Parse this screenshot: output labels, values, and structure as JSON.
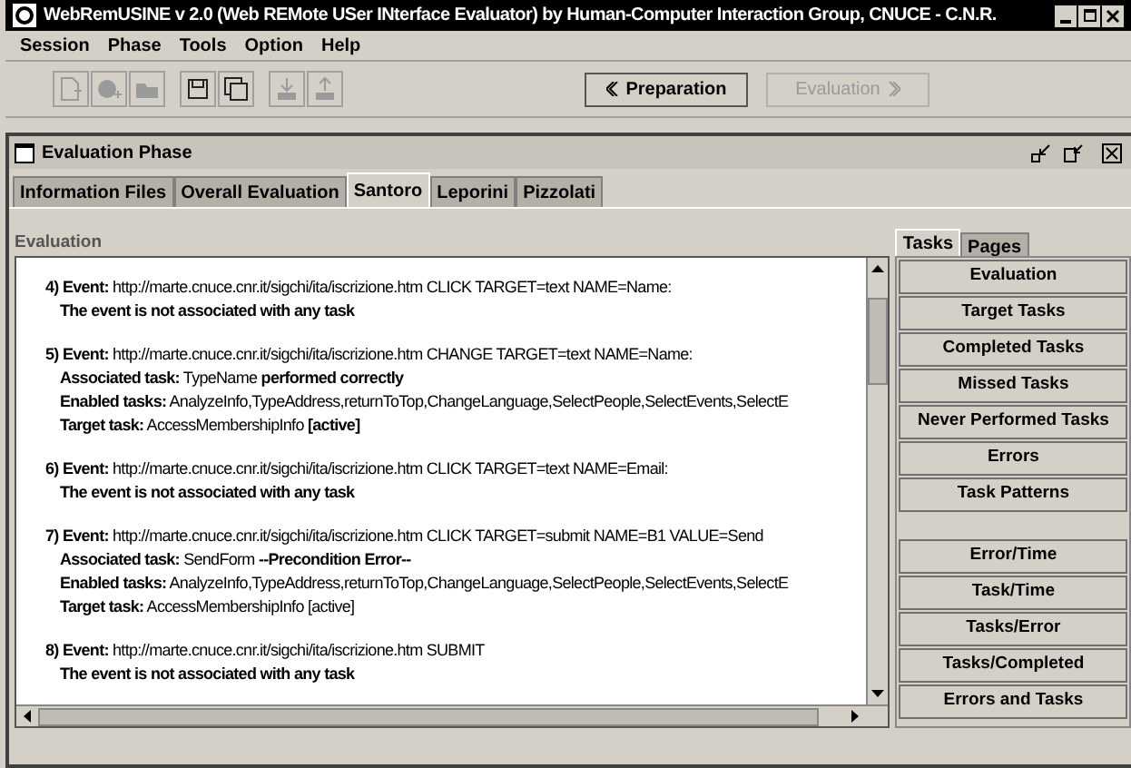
{
  "window": {
    "title": "WebRemUSINE v 2.0 (Web REMote USer INterface Evaluator) by Human-Computer Interaction Group, CNUCE - C.N.R."
  },
  "menu": [
    "Session",
    "Phase",
    "Tools",
    "Option",
    "Help"
  ],
  "toolbar": {
    "icons": [
      {
        "kind": "doc",
        "disabled": true
      },
      {
        "kind": "globe",
        "disabled": true
      },
      {
        "kind": "folder",
        "disabled": true
      },
      {
        "kind": "save",
        "disabled": false
      },
      {
        "kind": "saveall",
        "disabled": false
      },
      {
        "kind": "down",
        "disabled": true
      },
      {
        "kind": "up",
        "disabled": true
      }
    ],
    "nav": [
      {
        "label": "Preparation",
        "disabled": false
      },
      {
        "label": "Evaluation",
        "disabled": true
      }
    ]
  },
  "frame": {
    "title": "Evaluation Phase"
  },
  "tabs": [
    {
      "label": "Information Files",
      "selected": false
    },
    {
      "label": "Overall Evaluation",
      "selected": false
    },
    {
      "label": "Santoro",
      "selected": true
    },
    {
      "label": "Leporini",
      "selected": false
    },
    {
      "label": "Pizzolati",
      "selected": false
    }
  ],
  "evaluation": {
    "label": "Evaluation",
    "events": [
      {
        "lines": [
          {
            "text": "**4) Event:** http://marte.cnuce.cnr.it/sigchi/ita/iscrizione.htm CLICK TARGET=text NAME=Name:",
            "bold": false
          },
          {
            "text": "The event is not associated with any task",
            "bold": true
          }
        ]
      },
      {
        "lines": [
          {
            "text": "**5) Event:** http://marte.cnuce.cnr.it/sigchi/ita/iscrizione.htm CHANGE TARGET=text NAME=Name:",
            "bold": false
          },
          {
            "text": "**Associated task:** TypeName **performed correctly**",
            "bold": false
          },
          {
            "text": "**Enabled tasks:** AnalyzeInfo,TypeAddress,returnToTop,ChangeLanguage,SelectPeople,SelectEvents,SelectE",
            "bold": false
          },
          {
            "text": "**Target task:** AccessMembershipInfo **[active]**",
            "bold": false
          }
        ]
      },
      {
        "lines": [
          {
            "text": "**6) Event:** http://marte.cnuce.cnr.it/sigchi/ita/iscrizione.htm CLICK TARGET=text NAME=Email:",
            "bold": false
          },
          {
            "text": "The event is not associated with any task",
            "bold": true
          }
        ]
      },
      {
        "lines": [
          {
            "text": "**7) Event:** http://marte.cnuce.cnr.it/sigchi/ita/iscrizione.htm CLICK TARGET=submit NAME=B1 VALUE=Send",
            "bold": false
          },
          {
            "text": "**Associated task:** SendForm  **--Precondition Error--**",
            "bold": false
          },
          {
            "text": "**Enabled tasks:** AnalyzeInfo,TypeAddress,returnToTop,ChangeLanguage,SelectPeople,SelectEvents,SelectE",
            "bold": false
          },
          {
            "text": "**Target task:** AccessMembershipInfo [active]",
            "bold": false
          }
        ]
      },
      {
        "lines": [
          {
            "text": "**8) Event:** http://marte.cnuce.cnr.it/sigchi/ita/iscrizione.htm SUBMIT",
            "bold": false
          },
          {
            "text": "The event is not associated with any task",
            "bold": true
          }
        ]
      }
    ]
  },
  "side_tabs": [
    {
      "label": "Tasks",
      "selected": true
    },
    {
      "label": "Pages",
      "selected": false
    }
  ],
  "button_groups": [
    [
      "Evaluation",
      "Target Tasks",
      "Completed Tasks",
      "Missed Tasks",
      "Never Performed Tasks",
      "Errors",
      "Task Patterns"
    ],
    [
      "Error/Time",
      "Task/Time",
      "Tasks/Error",
      "Tasks/Completed",
      "Errors and Tasks"
    ]
  ]
}
